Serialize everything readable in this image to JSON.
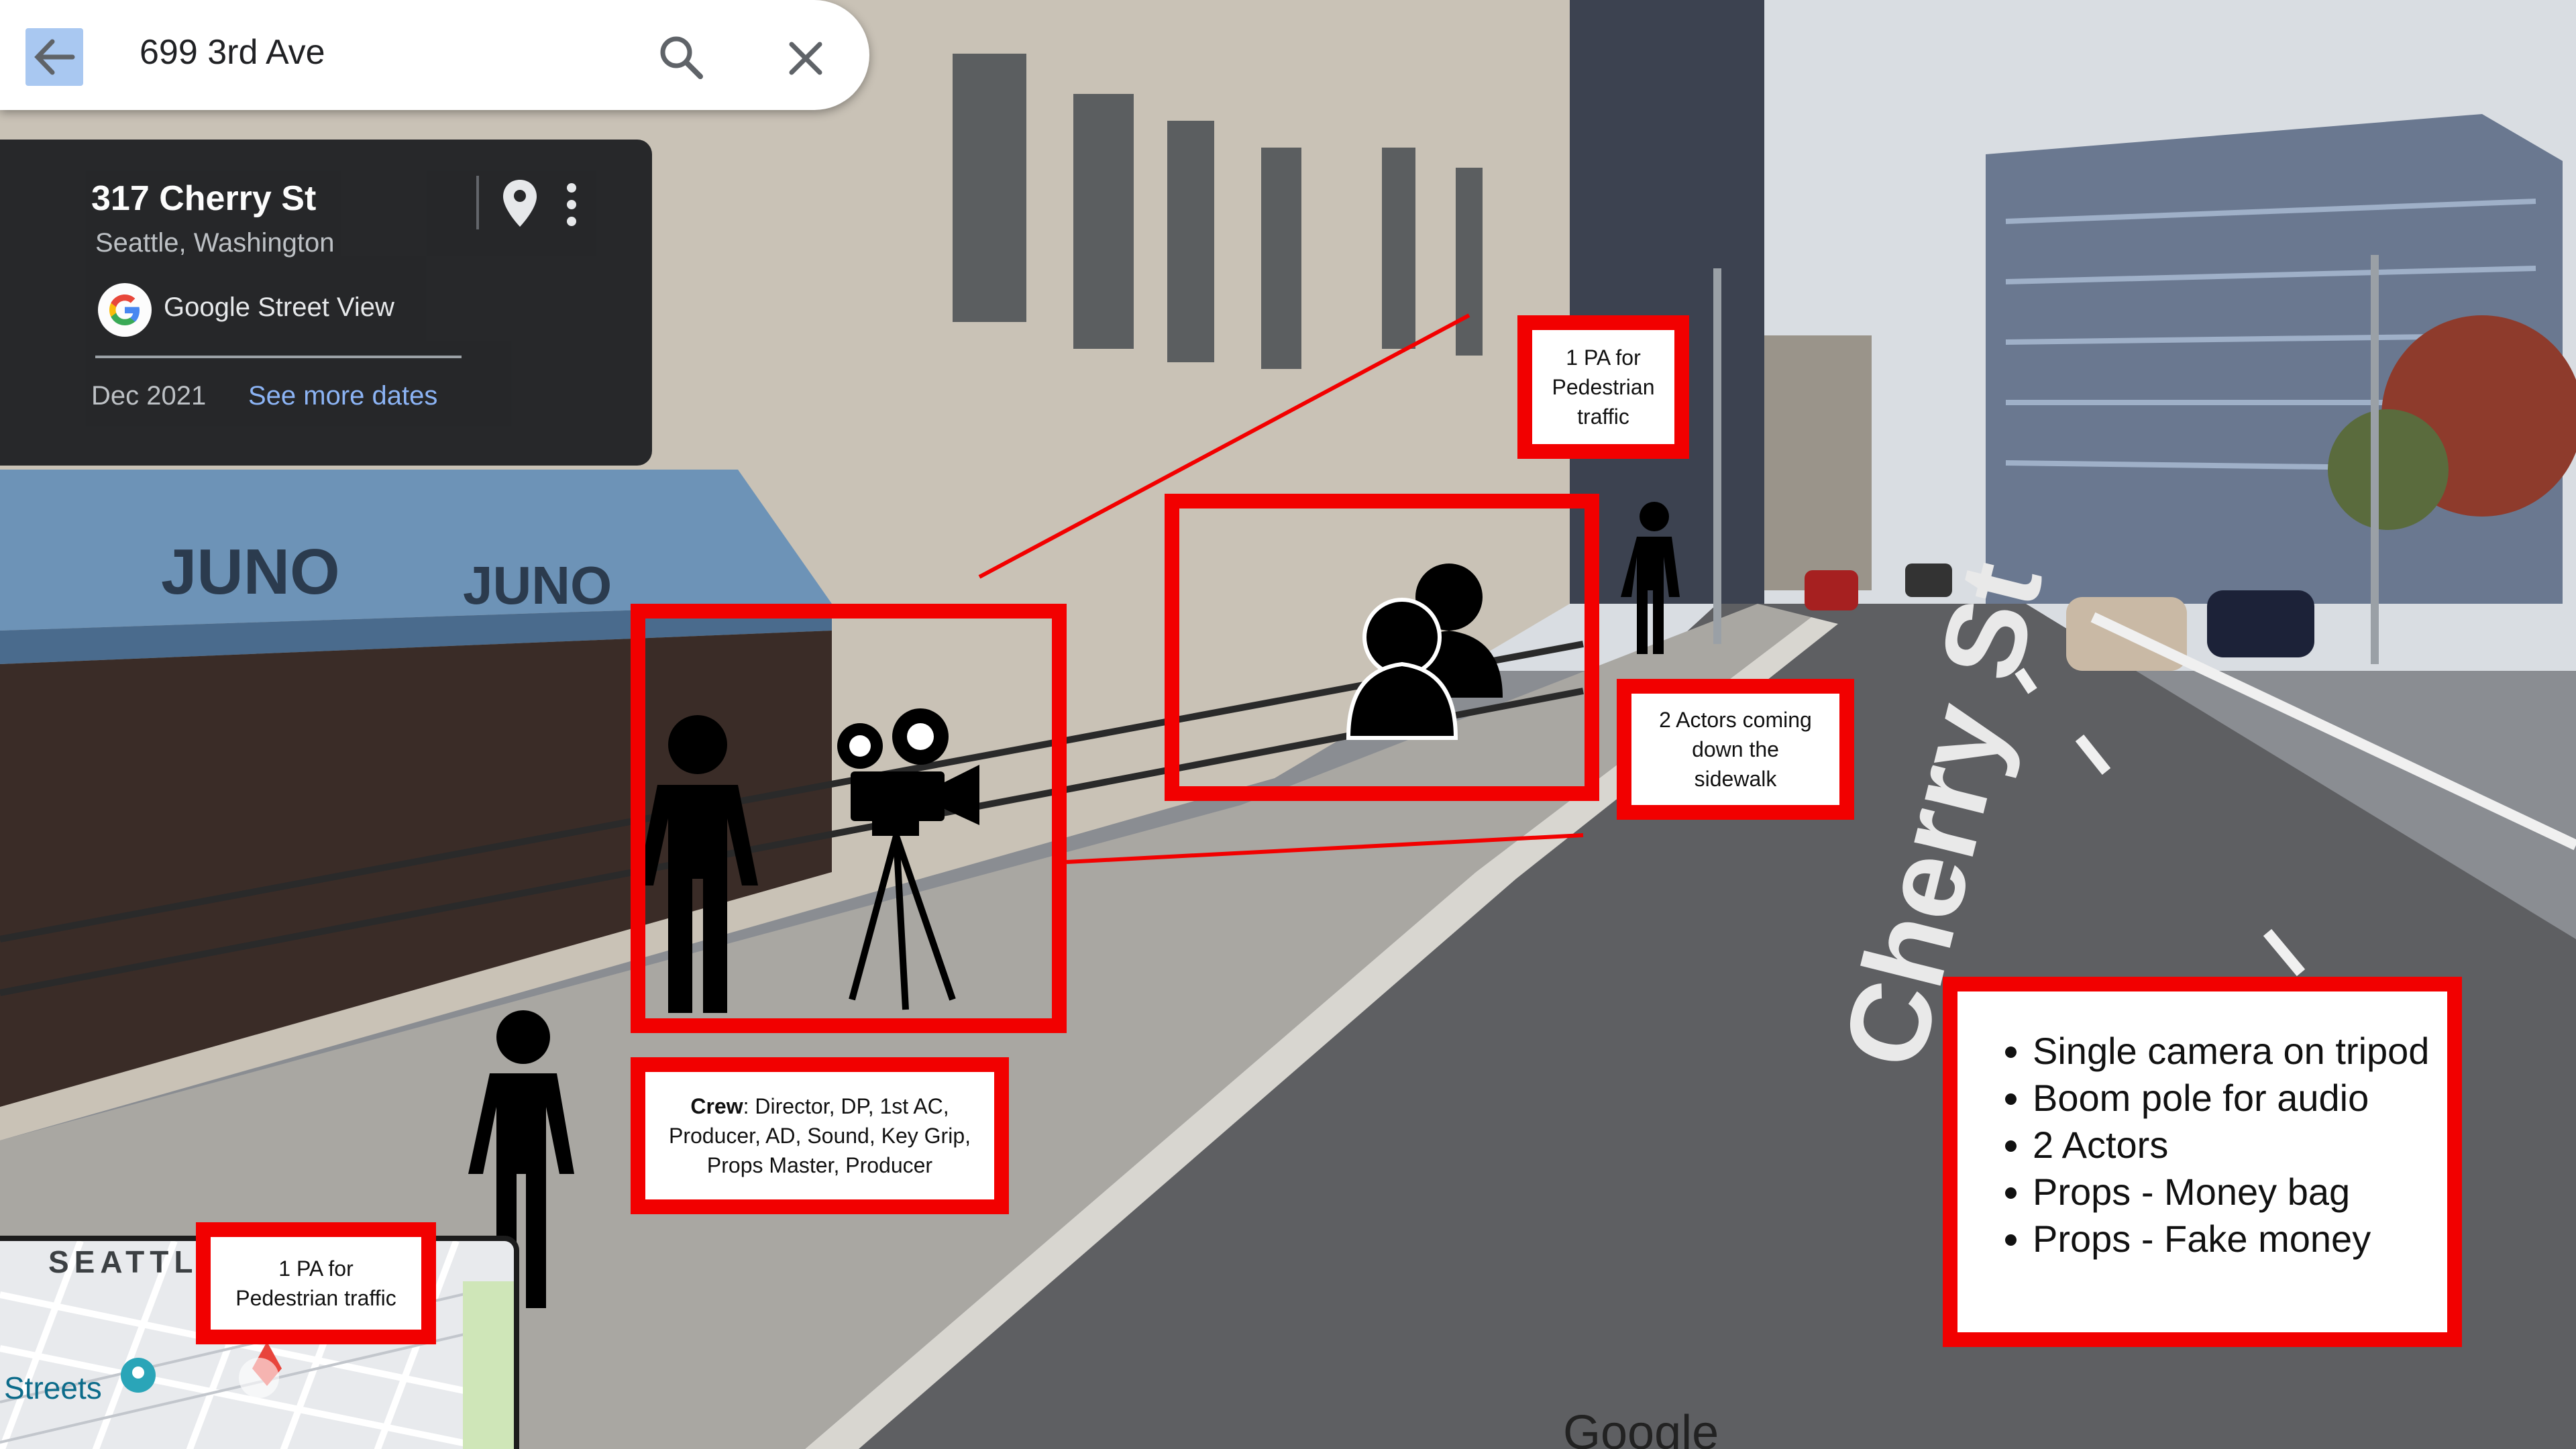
{
  "search": {
    "value": "699 3rd Ave",
    "back_icon": "arrow-left-icon",
    "search_icon": "search-icon",
    "close_icon": "close-icon"
  },
  "place": {
    "title": "317 Cherry St",
    "subtitle": "Seattle, Washington",
    "source": "Google Street View",
    "date": "Dec 2021",
    "see_more": "See more dates"
  },
  "scene": {
    "awning_text": [
      "JUNO",
      "JUNO"
    ],
    "street_text": "Cherry St",
    "watermark": "Google"
  },
  "annotations": {
    "pa_top": "1 PA for\nPedestrian\ntraffic",
    "actors": "2 Actors coming\ndown the\nsidewalk",
    "crew_label": "Crew",
    "crew_text": ": Director, DP, 1st AC,\nProducer, AD, Sound, Key Grip,\nProps Master, Producer",
    "pa_bottom": "1 PA for\nPedestrian traffic",
    "list": [
      "Single camera on tripod",
      "Boom pole for audio",
      "2 Actors",
      "Props - Money bag",
      "Props - Fake money"
    ]
  },
  "minimap": {
    "city": "SEATTLE",
    "streets": "Streets"
  },
  "colors": {
    "annotation_red": "#f20000",
    "card_bg": "#202124",
    "link_blue": "#8ab4f8"
  }
}
